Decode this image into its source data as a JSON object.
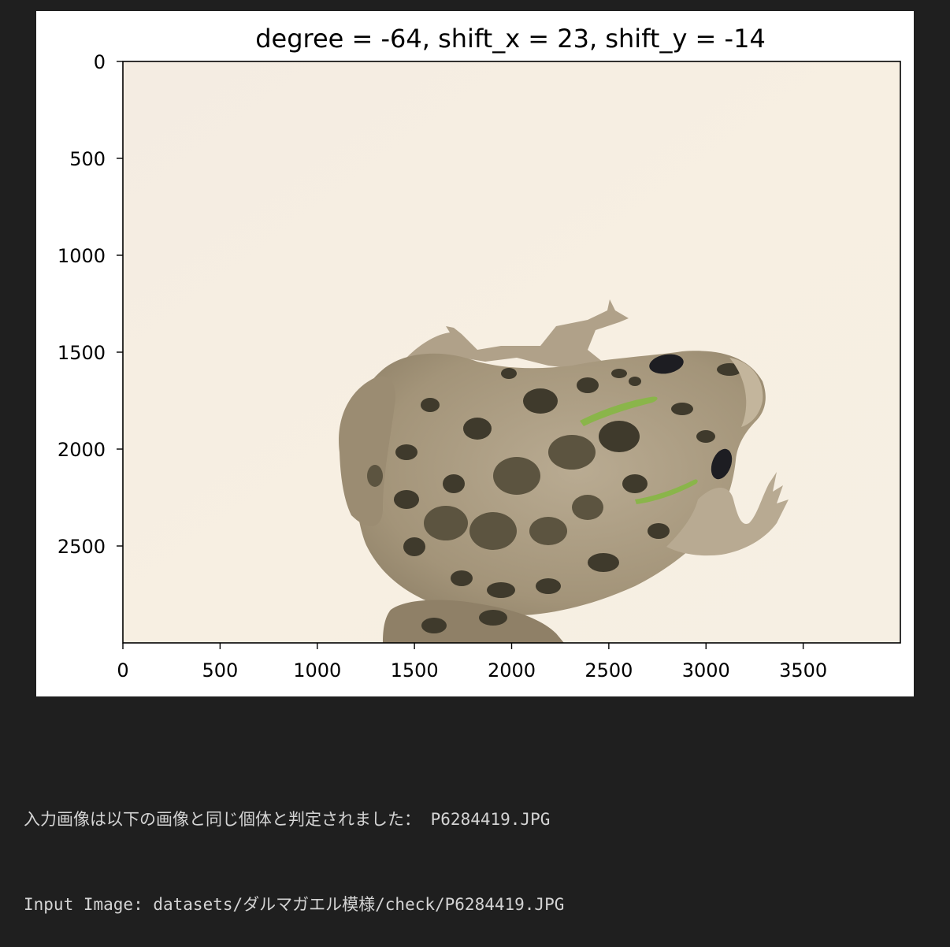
{
  "figure": {
    "title": "degree = -64, shift_x = 23, shift_y = -14",
    "image_subject": "spotted frog on cream background, photographed from above",
    "colors": {
      "background": "#f6efe2",
      "frog_body": "#a89a82",
      "frog_spots": "#3f3a2c",
      "frog_green_stripe": "#8ab54a"
    }
  },
  "chart_data": {
    "type": "image",
    "title": "degree = -64, shift_x = 23, shift_y = -14",
    "xlim": [
      0,
      4000
    ],
    "ylim": [
      3000,
      0
    ],
    "xticks": [
      0,
      500,
      1000,
      1500,
      2000,
      2500,
      3000,
      3500
    ],
    "yticks": [
      0,
      500,
      1000,
      1500,
      2000,
      2500
    ],
    "grid": false
  },
  "output": {
    "line1": "入力画像は以下の画像と同じ個体と判定されました： P6284419.JPG",
    "line2": "Input Image: datasets/ダルマガエル模様/check/P6284419.JPG"
  }
}
